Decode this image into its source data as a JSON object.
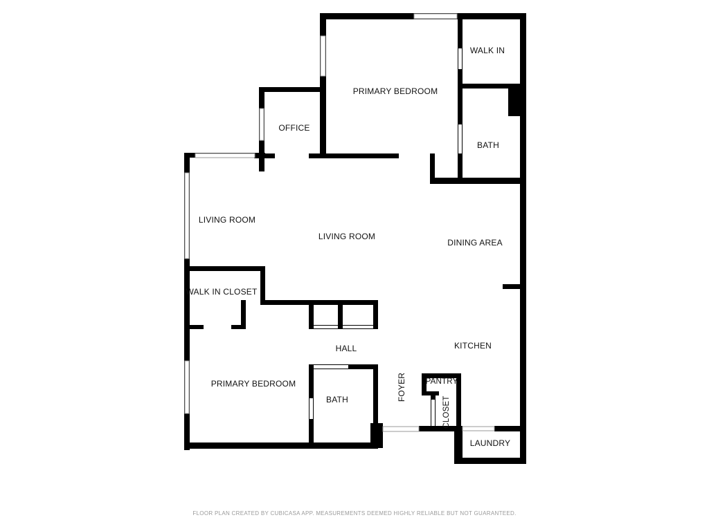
{
  "rooms": {
    "primary_bedroom_top": "PRIMARY BEDROOM",
    "walk_in_top": "WALK IN",
    "bath_top": "BATH",
    "office": "OFFICE",
    "living_room_left": "LIVING ROOM",
    "living_room_center": "LIVING ROOM",
    "dining_area": "DINING AREA",
    "walk_in_closet": "WALK IN CLOSET",
    "hall": "HALL",
    "kitchen": "KITCHEN",
    "primary_bedroom_bottom": "PRIMARY BEDROOM",
    "bath_bottom": "BATH",
    "foyer": "FOYER",
    "pantry": "PANTRY",
    "closet": "CLOSET",
    "laundry": "LAUNDRY"
  },
  "footer": {
    "disclaimer": "FLOOR PLAN CREATED BY CUBICASA APP. MEASUREMENTS DEEMED HIGHLY RELIABLE BUT NOT GUARANTEED."
  },
  "colors": {
    "wall": "#000000",
    "window_frame": "#9a9a9a",
    "background": "#ffffff",
    "footer_text": "#9a9a9a"
  }
}
